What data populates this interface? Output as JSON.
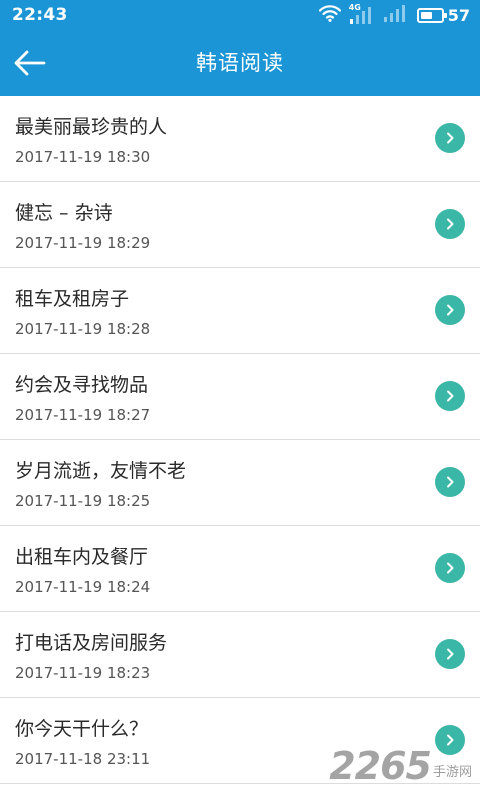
{
  "status_bar": {
    "time": "22:43",
    "signal_tag": "4G",
    "battery_level": "57",
    "battery_fraction": 0.57,
    "icons": [
      "wifi-icon",
      "signal-4g-icon",
      "signal-icon",
      "battery-icon"
    ]
  },
  "app_bar": {
    "title": "韩语阅读",
    "back_icon": "arrow-left-icon"
  },
  "articles": [
    {
      "title": "最美丽最珍贵的人",
      "date": "2017-11-19 18:30"
    },
    {
      "title": "健忘 – 杂诗",
      "date": "2017-11-19 18:29"
    },
    {
      "title": "租车及租房子",
      "date": "2017-11-19 18:28"
    },
    {
      "title": "约会及寻找物品",
      "date": "2017-11-19 18:27"
    },
    {
      "title": "岁月流逝，友情不老",
      "date": "2017-11-19 18:25"
    },
    {
      "title": "出租车内及餐厅",
      "date": "2017-11-19 18:24"
    },
    {
      "title": "打电话及房间服务",
      "date": "2017-11-19 18:23"
    },
    {
      "title": "你今天干什么？",
      "date": "2017-11-18 23:11"
    }
  ],
  "watermark": {
    "number": "2265",
    "text": "手游网"
  },
  "colors": {
    "header": "#1c95d6",
    "arrow_button": "#3ab7a7",
    "divider": "#dcdcdc"
  }
}
